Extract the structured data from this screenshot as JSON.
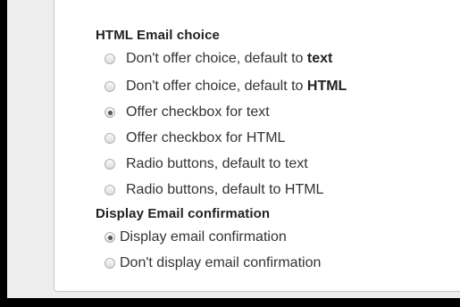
{
  "html_email_section": {
    "heading": "HTML Email choice",
    "options": [
      {
        "label": "Don't offer choice, default to ",
        "emphasis": "text",
        "checked": false
      },
      {
        "label": "Don't offer choice, default to ",
        "emphasis": "HTML",
        "checked": false
      },
      {
        "label": "Offer checkbox for text",
        "emphasis": "",
        "checked": true
      },
      {
        "label": "Offer checkbox for HTML",
        "emphasis": "",
        "checked": false
      },
      {
        "label": "Radio buttons, default to text",
        "emphasis": "",
        "checked": false
      },
      {
        "label": "Radio buttons, default to HTML",
        "emphasis": "",
        "checked": false
      }
    ]
  },
  "confirmation_section": {
    "heading": "Display Email confirmation",
    "options": [
      {
        "label": "Display email confirmation",
        "checked": true
      },
      {
        "label": "Don't display email confirmation",
        "checked": false
      }
    ]
  }
}
